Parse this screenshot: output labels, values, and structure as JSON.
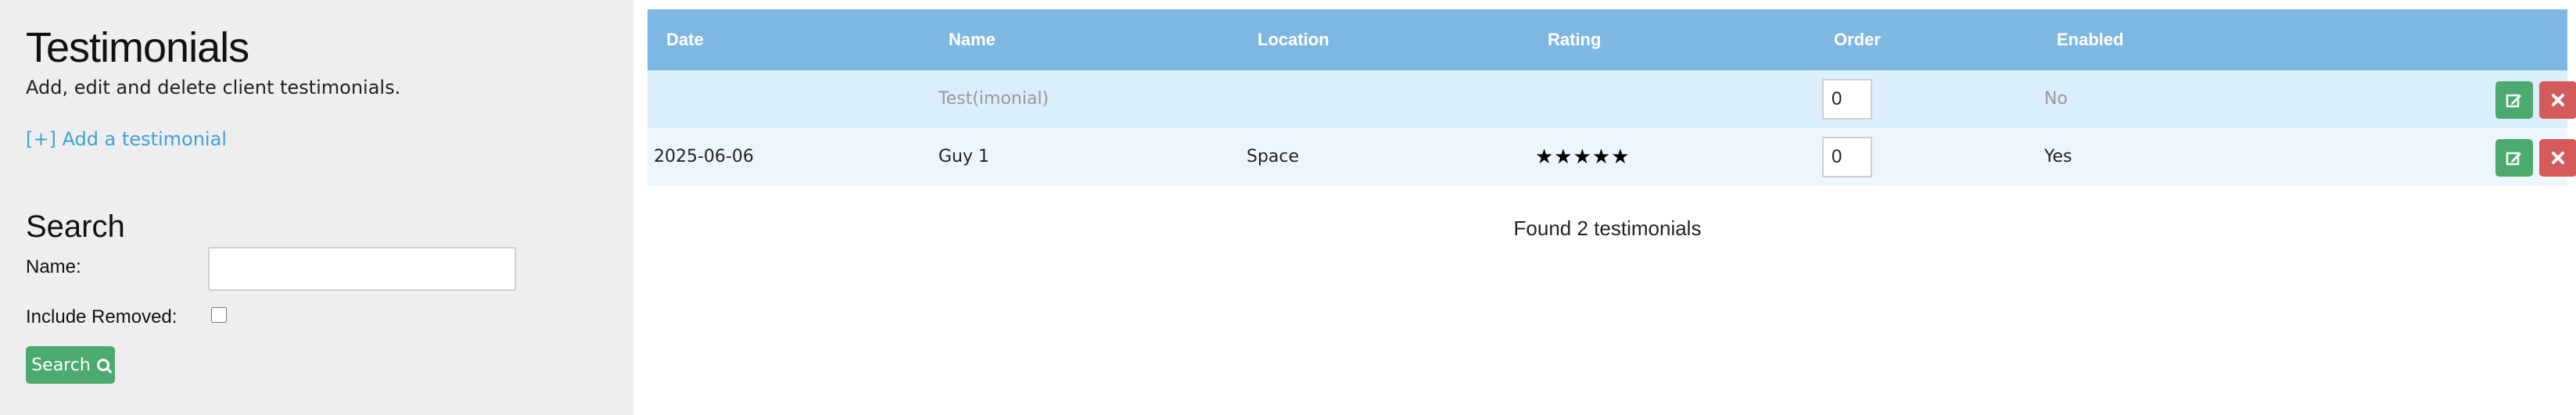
{
  "sidebar": {
    "title": "Testimonials",
    "subtitle": "Add, edit and delete client testimonials.",
    "add_link": "[+] Add a testimonial",
    "search_heading": "Search",
    "name_label": "Name:",
    "name_value": "",
    "include_removed_label": "Include Removed:",
    "include_removed_checked": false,
    "search_button": "Search",
    "search_icon": "search-icon"
  },
  "table": {
    "headers": [
      "Date",
      "Name",
      "Location",
      "Rating",
      "Order",
      "Enabled"
    ],
    "rows": [
      {
        "date": "",
        "name": "Test(imonial)",
        "location": "",
        "rating": 0,
        "rating_text": "",
        "order": "0",
        "enabled": "No",
        "muted": true
      },
      {
        "date": "2025-06-06",
        "name": "Guy 1",
        "location": "Space",
        "rating": 5,
        "rating_text": "★★★★★",
        "order": "0",
        "enabled": "Yes",
        "muted": false
      }
    ],
    "edit_icon": "edit-icon",
    "delete_icon": "close-icon"
  },
  "footer": {
    "found_text": "Found 2 testimonials"
  },
  "colors": {
    "header_bg": "#7fb7e3",
    "success": "#4daa6e",
    "danger": "#d55a5a",
    "link": "#3ea3d8"
  }
}
